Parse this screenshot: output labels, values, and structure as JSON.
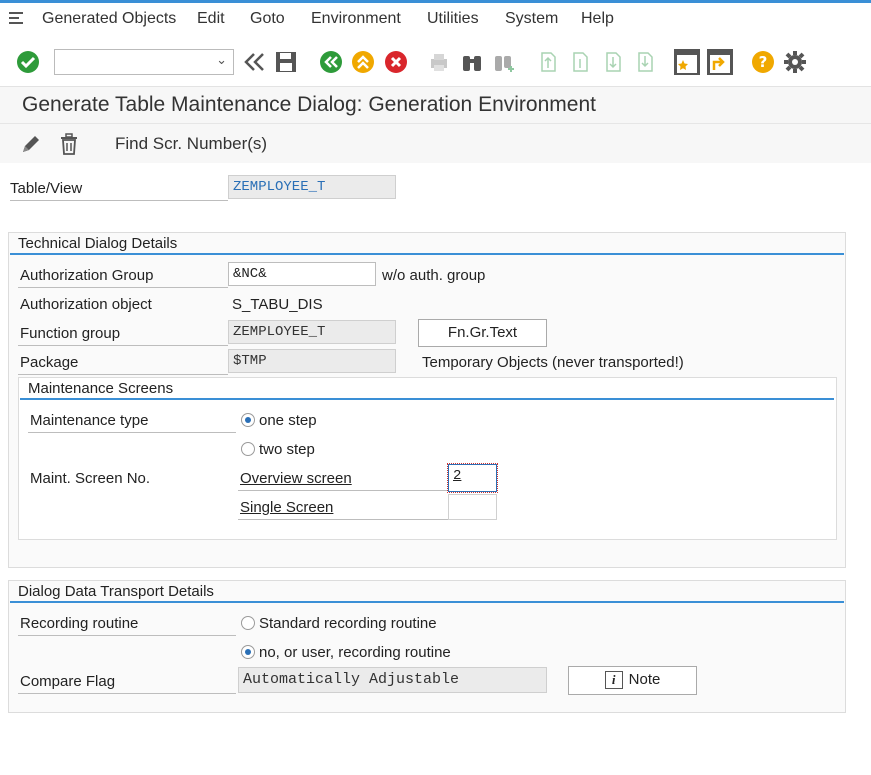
{
  "menu": [
    "Generated Objects",
    "Edit",
    "Goto",
    "Environment",
    "Utilities",
    "System",
    "Help"
  ],
  "title": "Generate Table Maintenance Dialog: Generation Environment",
  "app_toolbar": {
    "find_label": "Find Scr. Number(s)"
  },
  "table_view": {
    "label": "Table/View",
    "value": "ZEMPLOYEE_T"
  },
  "technical": {
    "heading": "Technical Dialog Details",
    "auth_group_label": "Authorization Group",
    "auth_group_value": "&NC&",
    "auth_group_desc": "w/o auth. group",
    "auth_object_label": "Authorization object",
    "auth_object_value": "S_TABU_DIS",
    "function_group_label": "Function group",
    "function_group_value": "ZEMPLOYEE_T",
    "fn_text_button": "Fn.Gr.Text",
    "package_label": "Package",
    "package_value": "$TMP",
    "package_desc": "Temporary Objects (never transported!)"
  },
  "maintenance": {
    "heading": "Maintenance Screens",
    "type_label": "Maintenance type",
    "one_step": "one step",
    "two_step": "two step",
    "screen_no_label": "Maint. Screen No.",
    "overview_label": "Overview screen",
    "overview_value": "2",
    "single_label": "Single Screen",
    "single_value": ""
  },
  "transport": {
    "heading": "Dialog Data Transport Details",
    "recording_label": "Recording routine",
    "standard_option": "Standard recording routine",
    "user_option": "no, or user, recording routine",
    "compare_label": "Compare Flag",
    "compare_value": "Automatically Adjustable",
    "note_button": "Note"
  },
  "colors": {
    "accent": "#3a8fd6",
    "ok_green": "#2e9b3a",
    "cancel_red": "#d9262c",
    "help_orange": "#f0a800"
  }
}
